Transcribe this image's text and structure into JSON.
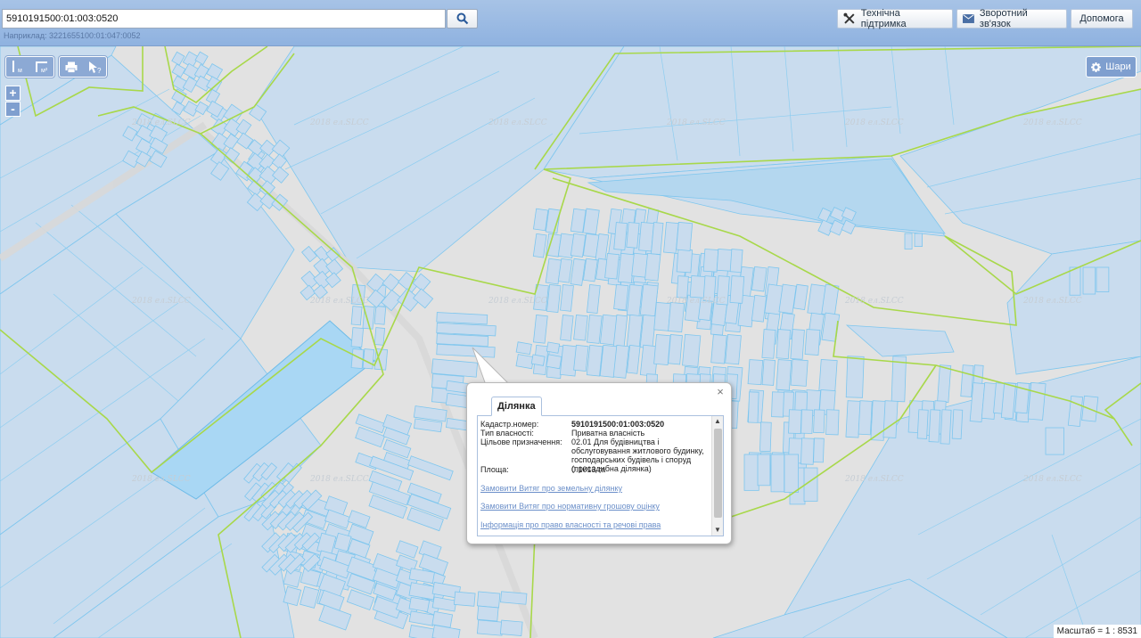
{
  "search": {
    "value": "5910191500:01:003:0520",
    "hint": "Наприклад: 3221655100:01:047:0052"
  },
  "header_buttons": {
    "support": "Технічна підтримка",
    "feedback": "Зворотний зв'язок",
    "help": "Допомога"
  },
  "layers_label": "Шари",
  "zoom": {
    "in": "+",
    "out": "-"
  },
  "tools": {
    "measure_distance": "м",
    "measure_area": "м²"
  },
  "watermark": "2018 ел.SLCC",
  "popup": {
    "tab": "Ділянка",
    "close": "×",
    "fields": [
      {
        "label": "Кадастр.номер:",
        "value": "5910191500:01:003:0520"
      },
      {
        "label": "Тип власності:",
        "value": "Приватна власність"
      },
      {
        "label": "Цільове призначення:",
        "value": "02.01 Для будівництва і обслуговування житлового будинку, господарських будівель і споруд (присадибна ділянка)"
      },
      {
        "label": "Площа:",
        "value": "0.1013 га"
      }
    ],
    "links": [
      "Замовити Витяг про земельну ділянку",
      "Замовити Витяг про нормативну грошову оцінку",
      "Інформація про право власності та речові права"
    ]
  },
  "scale_text": "Масштаб = 1 : 8531",
  "colors": {
    "parcel_fill": "#c9dcee",
    "parcel_stroke": "#7ec6ee",
    "boundary": "#a8d84a",
    "highlight": "#a9d7f4",
    "header": "#97b8e2"
  }
}
